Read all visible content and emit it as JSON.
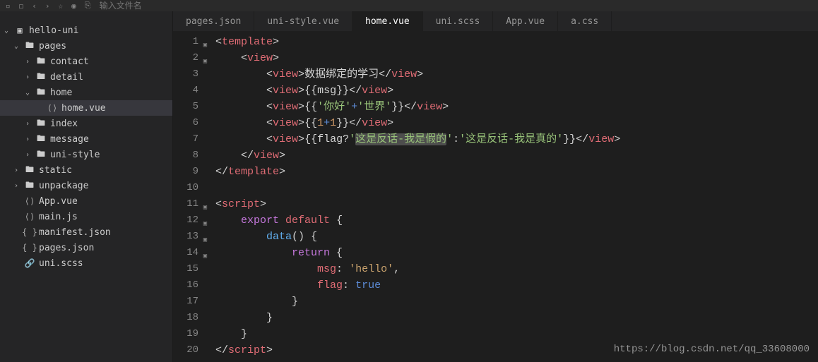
{
  "toolbar": {
    "search_placeholder": "输入文件名"
  },
  "sidebar": {
    "items": [
      {
        "label": "hello-uni",
        "icon": "proj",
        "arrow": "down",
        "indent": 0
      },
      {
        "label": "pages",
        "icon": "folder",
        "arrow": "down",
        "indent": 1
      },
      {
        "label": "contact",
        "icon": "folder",
        "arrow": "right",
        "indent": 2
      },
      {
        "label": "detail",
        "icon": "folder",
        "arrow": "right",
        "indent": 2
      },
      {
        "label": "home",
        "icon": "folder",
        "arrow": "down",
        "indent": 2
      },
      {
        "label": "home.vue",
        "icon": "vue",
        "arrow": "",
        "indent": 3,
        "active": true
      },
      {
        "label": "index",
        "icon": "folder",
        "arrow": "right",
        "indent": 2
      },
      {
        "label": "message",
        "icon": "folder",
        "arrow": "right",
        "indent": 2
      },
      {
        "label": "uni-style",
        "icon": "folder",
        "arrow": "right",
        "indent": 2
      },
      {
        "label": "static",
        "icon": "folder",
        "arrow": "right",
        "indent": 1
      },
      {
        "label": "unpackage",
        "icon": "folder",
        "arrow": "right",
        "indent": 1
      },
      {
        "label": "App.vue",
        "icon": "vue",
        "arrow": "",
        "indent": 1
      },
      {
        "label": "main.js",
        "icon": "js",
        "arrow": "",
        "indent": 1
      },
      {
        "label": "manifest.json",
        "icon": "json",
        "arrow": "",
        "indent": 1
      },
      {
        "label": "pages.json",
        "icon": "json",
        "arrow": "",
        "indent": 1
      },
      {
        "label": "uni.scss",
        "icon": "scss",
        "arrow": "",
        "indent": 1
      }
    ]
  },
  "tabs": [
    {
      "label": "pages.json",
      "active": false
    },
    {
      "label": "uni-style.vue",
      "active": false
    },
    {
      "label": "home.vue",
      "active": true
    },
    {
      "label": "uni.scss",
      "active": false
    },
    {
      "label": "App.vue",
      "active": false
    },
    {
      "label": "a.css",
      "active": false
    }
  ],
  "code": {
    "max_line": 20,
    "lines": [
      {
        "n": 1,
        "fold": true,
        "tokens": [
          [
            "<",
            "t-punc"
          ],
          [
            "template",
            "t-tag"
          ],
          [
            ">",
            "t-punc"
          ]
        ]
      },
      {
        "n": 2,
        "fold": true,
        "indent": 1,
        "tokens": [
          [
            "<",
            "t-punc"
          ],
          [
            "view",
            "t-tag"
          ],
          [
            ">",
            "t-punc"
          ]
        ]
      },
      {
        "n": 3,
        "indent": 2,
        "tokens": [
          [
            "<",
            "t-punc"
          ],
          [
            "view",
            "t-tag"
          ],
          [
            ">",
            "t-punc"
          ],
          [
            "数据绑定的学习",
            "t-text"
          ],
          [
            "</",
            "t-punc"
          ],
          [
            "view",
            "t-tag"
          ],
          [
            ">",
            "t-punc"
          ]
        ]
      },
      {
        "n": 4,
        "indent": 2,
        "tokens": [
          [
            "<",
            "t-punc"
          ],
          [
            "view",
            "t-tag"
          ],
          [
            ">",
            "t-punc"
          ],
          [
            "{{msg}}",
            "t-text"
          ],
          [
            "</",
            "t-punc"
          ],
          [
            "view",
            "t-tag"
          ],
          [
            ">",
            "t-punc"
          ]
        ]
      },
      {
        "n": 5,
        "indent": 2,
        "tokens": [
          [
            "<",
            "t-punc"
          ],
          [
            "view",
            "t-tag"
          ],
          [
            ">",
            "t-punc"
          ],
          [
            "{{",
            "t-text"
          ],
          [
            "'你好'",
            "t-str"
          ],
          [
            "+",
            "t-nav"
          ],
          [
            "'世界'",
            "t-str"
          ],
          [
            "}}",
            "t-text"
          ],
          [
            "</",
            "t-punc"
          ],
          [
            "view",
            "t-tag"
          ],
          [
            ">",
            "t-punc"
          ]
        ]
      },
      {
        "n": 6,
        "indent": 2,
        "tokens": [
          [
            "<",
            "t-punc"
          ],
          [
            "view",
            "t-tag"
          ],
          [
            ">",
            "t-punc"
          ],
          [
            "{{",
            "t-text"
          ],
          [
            "1",
            "t-num"
          ],
          [
            "+",
            "t-nav"
          ],
          [
            "1",
            "t-num"
          ],
          [
            "}}",
            "t-text"
          ],
          [
            "</",
            "t-punc"
          ],
          [
            "view",
            "t-tag"
          ],
          [
            ">",
            "t-punc"
          ]
        ]
      },
      {
        "n": 7,
        "indent": 2,
        "tokens": [
          [
            "<",
            "t-punc"
          ],
          [
            "view",
            "t-tag"
          ],
          [
            ">",
            "t-punc"
          ],
          [
            "{{flag?",
            "t-text"
          ],
          [
            "'",
            "t-str"
          ],
          [
            "这是反话-我是假的",
            "t-str t-sel"
          ],
          [
            "'",
            "t-str"
          ],
          [
            ":",
            "t-text"
          ],
          [
            "'这是反话-我是真的'",
            "t-str"
          ],
          [
            "}}",
            "t-text"
          ],
          [
            "</",
            "t-punc"
          ],
          [
            "view",
            "t-tag"
          ],
          [
            ">",
            "t-punc"
          ]
        ]
      },
      {
        "n": 8,
        "indent": 1,
        "tokens": [
          [
            "</",
            "t-punc"
          ],
          [
            "view",
            "t-tag"
          ],
          [
            ">",
            "t-punc"
          ]
        ]
      },
      {
        "n": 9,
        "tokens": [
          [
            "</",
            "t-punc"
          ],
          [
            "template",
            "t-tag"
          ],
          [
            ">",
            "t-punc"
          ]
        ]
      },
      {
        "n": 10,
        "tokens": []
      },
      {
        "n": 11,
        "fold": true,
        "tokens": [
          [
            "<",
            "t-punc"
          ],
          [
            "script",
            "t-tag"
          ],
          [
            ">",
            "t-punc"
          ]
        ]
      },
      {
        "n": 12,
        "fold": true,
        "indent": 1,
        "tokens": [
          [
            "export",
            "t-kw"
          ],
          [
            " ",
            "t-punc"
          ],
          [
            "default",
            "t-kw2"
          ],
          [
            " {",
            "t-punc"
          ]
        ]
      },
      {
        "n": 13,
        "fold": true,
        "indent": 2,
        "tokens": [
          [
            "data",
            "t-fn"
          ],
          [
            "() {",
            "t-punc"
          ]
        ]
      },
      {
        "n": 14,
        "fold": true,
        "indent": 3,
        "tokens": [
          [
            "return",
            "t-kw"
          ],
          [
            " {",
            "t-punc"
          ]
        ]
      },
      {
        "n": 15,
        "indent": 4,
        "tokens": [
          [
            "msg",
            "t-id"
          ],
          [
            ": ",
            "t-punc"
          ],
          [
            "'hello'",
            "t-str2"
          ],
          [
            ",",
            "t-punc"
          ]
        ]
      },
      {
        "n": 16,
        "indent": 4,
        "tokens": [
          [
            "flag",
            "t-id"
          ],
          [
            ": ",
            "t-punc"
          ],
          [
            "true",
            "t-nav"
          ]
        ]
      },
      {
        "n": 17,
        "indent": 3,
        "tokens": [
          [
            "}",
            "t-punc"
          ]
        ]
      },
      {
        "n": 18,
        "indent": 2,
        "tokens": [
          [
            "}",
            "t-punc"
          ]
        ]
      },
      {
        "n": 19,
        "indent": 1,
        "tokens": [
          [
            "}",
            "t-punc"
          ]
        ]
      },
      {
        "n": 20,
        "tokens": [
          [
            "</",
            "t-punc"
          ],
          [
            "script",
            "t-tag"
          ],
          [
            ">",
            "t-punc"
          ]
        ]
      }
    ]
  },
  "watermark": "https://blog.csdn.net/qq_33608000"
}
